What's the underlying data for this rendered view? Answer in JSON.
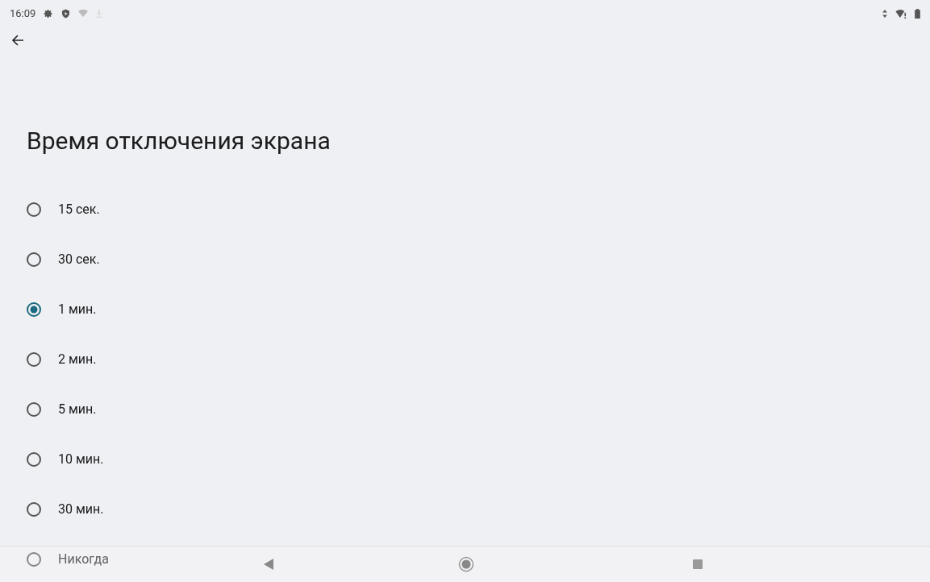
{
  "status_bar": {
    "time": "16:09"
  },
  "title": "Время отключения экрана",
  "options": [
    {
      "label": "15 сек.",
      "selected": false
    },
    {
      "label": "30 сек.",
      "selected": false
    },
    {
      "label": "1 мин.",
      "selected": true
    },
    {
      "label": "2 мин.",
      "selected": false
    },
    {
      "label": "5 мин.",
      "selected": false
    },
    {
      "label": "10 мин.",
      "selected": false
    },
    {
      "label": "30 мин.",
      "selected": false
    },
    {
      "label": "Никогда",
      "selected": false
    }
  ]
}
